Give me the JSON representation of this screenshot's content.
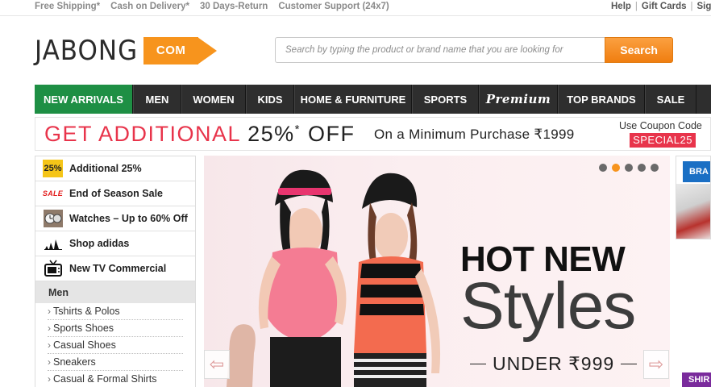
{
  "topbar": {
    "left": [
      "Free Shipping*",
      "Cash on Delivery*",
      "30 Days-Return",
      "Customer Support (24x7)"
    ],
    "right": [
      "Help",
      "Gift Cards",
      "Sign"
    ]
  },
  "logo": {
    "word": "JABONG",
    "suffix": "COM"
  },
  "search": {
    "placeholder": "Search by typing the product or brand name that you are looking for",
    "button": "Search"
  },
  "nav": [
    "NEW ARRIVALS",
    "MEN",
    "WOMEN",
    "KIDS",
    "HOME & FURNITURE",
    "SPORTS",
    "Premium",
    "TOP BRANDS",
    "SALE"
  ],
  "promo": {
    "red_text": "GET ADDITIONAL ",
    "percent": "25%",
    "star": "*",
    "off": " OFF",
    "minimum": "On a  Minimum Purchase ₹1999",
    "coupon_label": "Use Coupon Code",
    "coupon_code": "SPECIAL25"
  },
  "sidebar": {
    "offers": [
      {
        "icon_text": "25%",
        "label": "Additional 25%"
      },
      {
        "icon_text": "SALE",
        "label": "End of Season Sale"
      },
      {
        "icon_text": "",
        "label": "Watches – Up to 60% Off"
      },
      {
        "icon_text": "",
        "label": "Shop adidas"
      },
      {
        "icon_text": "",
        "label": "New TV Commercial"
      }
    ],
    "section": "Men",
    "links": [
      "Tshirts & Polos",
      "Sports Shoes",
      "Casual Shoes",
      "Sneakers",
      "Casual & Formal Shirts"
    ]
  },
  "banner": {
    "headline": "HOT NEW",
    "script": "Styles",
    "price": "UNDER ₹999",
    "active_slide": 2,
    "slide_count": 5
  },
  "edge_ads": [
    "BRA",
    "SHIR"
  ],
  "colors": {
    "accent_orange": "#f7941d",
    "nav_dark": "#2e2e2e",
    "nav_green": "#1e8f44",
    "promo_red": "#e8344b"
  }
}
